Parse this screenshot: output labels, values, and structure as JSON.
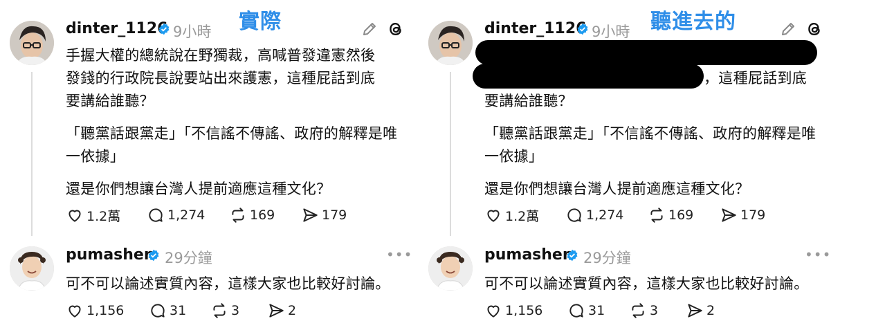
{
  "captions": {
    "left": "實際",
    "right": "聽進去的"
  },
  "post1": {
    "username": "dinter_1126",
    "time": "9小時",
    "lines": [
      "手握大權的總統說在野獨裁，高喊普發違憲然後",
      "發錢的行政院長說要站出來護憲，這種屁話到底",
      "要講給誰聽？",
      "「聽黨話跟黨走」「不信謠不傳謠、政府的解釋是唯",
      "一依據」",
      "還是你們想讓台灣人提前適應這種文化？"
    ],
    "right_visible_fragment": "，這種屁話到底",
    "stats": {
      "likes": "1.2萬",
      "replies": "1,274",
      "reposts": "169",
      "shares": "179"
    }
  },
  "post2": {
    "username": "pumashen",
    "time": "29分鐘",
    "text": "可不可以論述實質內容，這樣大家也比較好討論。",
    "stats": {
      "likes": "1,156",
      "replies": "31",
      "reposts": "3",
      "shares": "2"
    }
  },
  "icons": {
    "verified": "verified-badge-icon",
    "edit": "pencil-icon",
    "app": "threads-icon",
    "like": "heart-icon",
    "reply": "comment-icon",
    "repost": "repost-icon",
    "share": "send-icon",
    "more": "more-icon"
  },
  "colors": {
    "caption": "#2f8ee8",
    "verified": "#1d9bf0",
    "muted": "#9a9a9a"
  }
}
